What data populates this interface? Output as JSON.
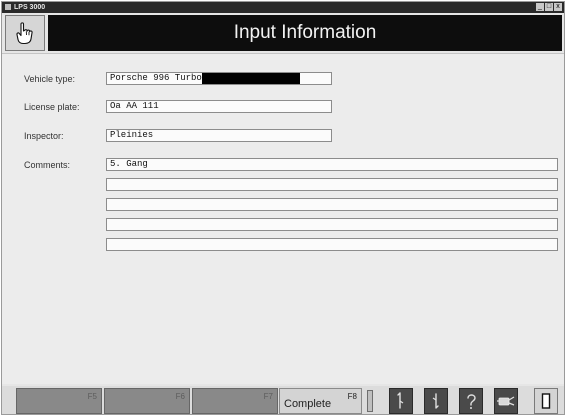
{
  "window": {
    "app_title": "LPS 3000",
    "controls": [
      "_",
      "□",
      "x"
    ]
  },
  "header": {
    "title": "Input Information",
    "home_icon": "pointing-hand-icon"
  },
  "form": {
    "vehicle_type": {
      "label": "Vehicle type:",
      "value": "Porsche 996 Turbo"
    },
    "license_plate": {
      "label": "License plate:",
      "value": "Oa AA 111"
    },
    "inspector": {
      "label": "Inspector:",
      "value": "Pleinies"
    },
    "comments": {
      "label": "Comments:",
      "lines": [
        "5. Gang",
        "",
        "",
        "",
        ""
      ]
    }
  },
  "footer": {
    "fkeys": [
      {
        "key": "F5",
        "label": ""
      },
      {
        "key": "F6",
        "label": ""
      },
      {
        "key": "F7",
        "label": ""
      },
      {
        "key": "F8",
        "label": "Complete"
      }
    ],
    "tools": [
      "left-hand-icon",
      "right-hand-icon",
      "question-icon",
      "connector-icon",
      "document-icon"
    ]
  }
}
